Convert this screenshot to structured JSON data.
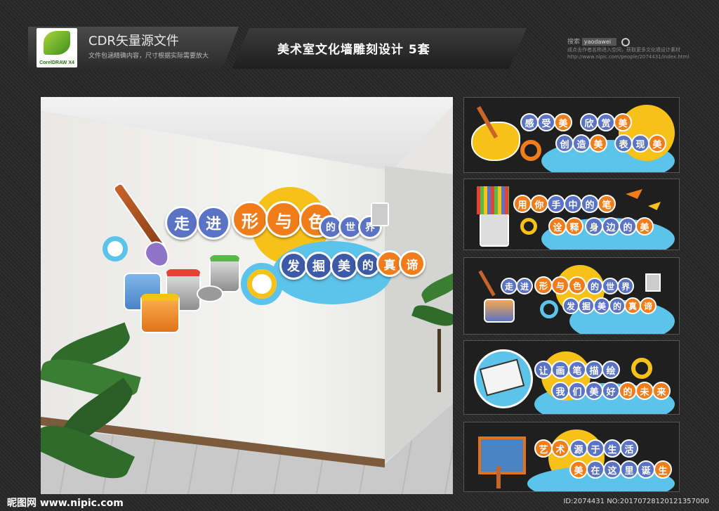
{
  "header": {
    "logo_text": "CorelDRAW X4",
    "cdr_title": "CDR矢量源文件",
    "cdr_subtitle": "文件包涵精确内容，尺寸根据实际需要放大",
    "main_title": "美术室文化墙雕刻设计   5套",
    "search_label": "搜索",
    "search_value": "yaodawei",
    "search_note": "成点击作者名称进入空间，获取更多文化墙设计素材 http://www.nipic.com/people/2074431/index.html"
  },
  "scene": {
    "line1": [
      "走",
      "进",
      "形",
      "与",
      "色",
      "的",
      "世",
      "界"
    ],
    "line2": [
      "发",
      "掘",
      "美",
      "的",
      "真",
      "谛"
    ]
  },
  "panels": [
    {
      "line1": [
        "感",
        "受",
        "美",
        "欣",
        "赏",
        "美"
      ],
      "line2": [
        "创",
        "造",
        "美",
        "表",
        "现",
        "美"
      ]
    },
    {
      "line1": [
        "用",
        "你",
        "手",
        "中",
        "的",
        "笔"
      ],
      "line2": [
        "诠",
        "释",
        "身",
        "边",
        "的",
        "美"
      ]
    },
    {
      "line1": [
        "走",
        "进",
        "形",
        "与",
        "色",
        "的",
        "世",
        "界"
      ],
      "line2": [
        "发",
        "掘",
        "美",
        "的",
        "真",
        "谛"
      ]
    },
    {
      "line1": [
        "让",
        "画",
        "笔",
        "描",
        "绘"
      ],
      "line2": [
        "我",
        "们",
        "美",
        "好",
        "的",
        "未",
        "来"
      ]
    },
    {
      "line1": [
        "艺",
        "术",
        "源",
        "于",
        "生",
        "活"
      ],
      "line2": [
        "美",
        "在",
        "这",
        "里",
        "诞",
        "生"
      ]
    }
  ],
  "footer": {
    "site": "昵图网 www.nipic.com",
    "id": "ID:2074431 NO:20170728120121357000"
  },
  "colors": {
    "blue": "#5b73c4",
    "orange": "#f07d1a",
    "yellow": "#f6c21a",
    "cyan": "#5cc3ea"
  }
}
